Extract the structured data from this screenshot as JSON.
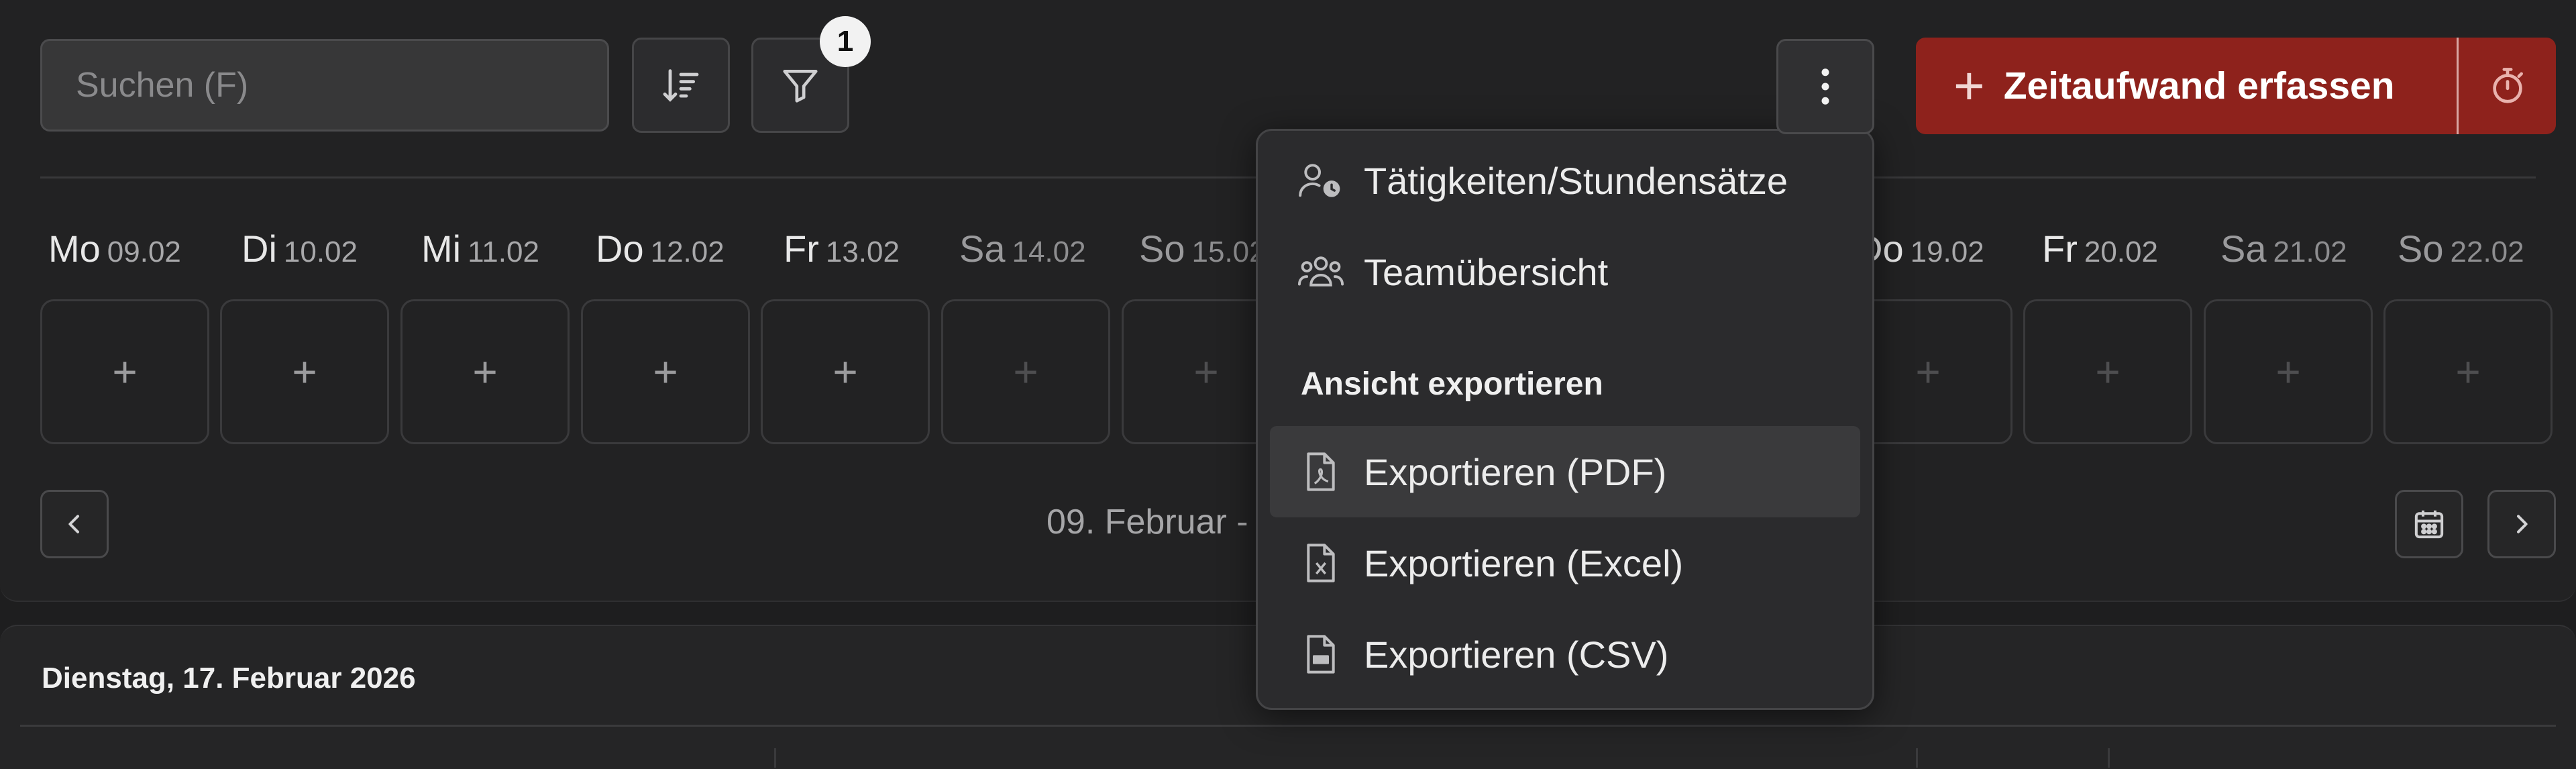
{
  "toolbar": {
    "search_placeholder": "Suchen (F)",
    "filter_badge": "1",
    "primary_button_label": "Zeitaufwand erfassen",
    "primary_button_plus": "+"
  },
  "week": {
    "days": [
      {
        "day": "Mo",
        "date": "09.02",
        "weekend": false
      },
      {
        "day": "Di",
        "date": "10.02",
        "weekend": false
      },
      {
        "day": "Mi",
        "date": "11.02",
        "weekend": false
      },
      {
        "day": "Do",
        "date": "12.02",
        "weekend": false
      },
      {
        "day": "Fr",
        "date": "13.02",
        "weekend": false
      },
      {
        "day": "Sa",
        "date": "14.02",
        "weekend": true
      },
      {
        "day": "So",
        "date": "15.02",
        "weekend": true
      },
      {
        "day": "Do",
        "date": "19.02",
        "weekend": false
      },
      {
        "day": "Fr",
        "date": "20.02",
        "weekend": false
      },
      {
        "day": "Sa",
        "date": "21.02",
        "weekend": true
      },
      {
        "day": "So",
        "date": "22.02",
        "weekend": true
      }
    ],
    "add_symbol": "+",
    "range_label": "09. Februar -"
  },
  "menu": {
    "items": [
      {
        "label": "Tätigkeiten/Stundensätze",
        "icon": "user-clock-icon"
      },
      {
        "label": "Teamübersicht",
        "icon": "team-icon"
      }
    ],
    "section_title": "Ansicht exportieren",
    "export_items": [
      {
        "label": "Exportieren (PDF)",
        "icon": "pdf-file-icon",
        "active": true
      },
      {
        "label": "Exportieren (Excel)",
        "icon": "excel-file-icon",
        "active": false
      },
      {
        "label": "Exportieren (CSV)",
        "icon": "csv-file-icon",
        "active": false
      }
    ]
  },
  "day_section": {
    "title": "Dienstag, 17. Februar 2026"
  },
  "colors": {
    "background": "#1e1e1f",
    "primary": "#8e221c",
    "menu_bg": "#2b2b2d"
  }
}
